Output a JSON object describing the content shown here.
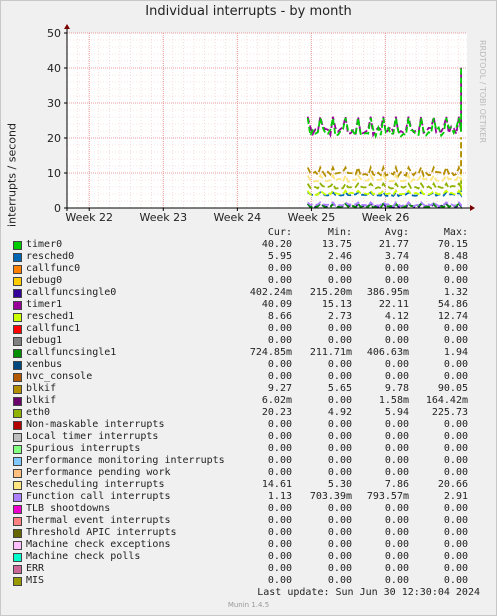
{
  "title": "Individual interrupts - by month",
  "watermark": "RRDTOOL / TOBI OETIKER",
  "footer": {
    "last_update": "Last update:  Sun Jun 30 12:30:04 2024",
    "version": "Munin 1.4.5"
  },
  "legend_headers": {
    "cur": "Cur:",
    "min": "Min:",
    "avg": "Avg:",
    "max": "Max:"
  },
  "legend": [
    {
      "name": "timer0",
      "color": "#00cc00",
      "cur": "40.20",
      "min": "13.75",
      "avg": "21.77",
      "max": "70.15"
    },
    {
      "name": "resched0",
      "color": "#0066b3",
      "cur": "5.95",
      "min": "2.46",
      "avg": "3.74",
      "max": "8.48"
    },
    {
      "name": "callfunc0",
      "color": "#ff8000",
      "cur": "0.00",
      "min": "0.00",
      "avg": "0.00",
      "max": "0.00"
    },
    {
      "name": "debug0",
      "color": "#ffcc00",
      "cur": "0.00",
      "min": "0.00",
      "avg": "0.00",
      "max": "0.00"
    },
    {
      "name": "callfuncsingle0",
      "color": "#330099",
      "cur": "402.24m",
      "min": "215.20m",
      "avg": "386.95m",
      "max": "1.32"
    },
    {
      "name": "timer1",
      "color": "#990099",
      "cur": "40.09",
      "min": "15.13",
      "avg": "22.11",
      "max": "54.86"
    },
    {
      "name": "resched1",
      "color": "#ccff00",
      "cur": "8.66",
      "min": "2.73",
      "avg": "4.12",
      "max": "12.74"
    },
    {
      "name": "callfunc1",
      "color": "#ff0000",
      "cur": "0.00",
      "min": "0.00",
      "avg": "0.00",
      "max": "0.00"
    },
    {
      "name": "debug1",
      "color": "#808080",
      "cur": "0.00",
      "min": "0.00",
      "avg": "0.00",
      "max": "0.00"
    },
    {
      "name": "callfuncsingle1",
      "color": "#008f00",
      "cur": "724.85m",
      "min": "211.71m",
      "avg": "406.63m",
      "max": "1.94"
    },
    {
      "name": "xenbus",
      "color": "#00487d",
      "cur": "0.00",
      "min": "0.00",
      "avg": "0.00",
      "max": "0.00"
    },
    {
      "name": "hvc_console",
      "color": "#b35a00",
      "cur": "0.00",
      "min": "0.00",
      "avg": "0.00",
      "max": "0.00"
    },
    {
      "name": "blkif",
      "color": "#b38f00",
      "cur": "9.27",
      "min": "5.65",
      "avg": "9.78",
      "max": "90.05"
    },
    {
      "name": "blkif",
      "color": "#6b006b",
      "cur": "6.02m",
      "min": "0.00",
      "avg": "1.58m",
      "max": "164.42m"
    },
    {
      "name": "eth0",
      "color": "#8fb300",
      "cur": "20.23",
      "min": "4.92",
      "avg": "5.94",
      "max": "225.73"
    },
    {
      "name": "Non-maskable interrupts",
      "color": "#b30000",
      "cur": "0.00",
      "min": "0.00",
      "avg": "0.00",
      "max": "0.00"
    },
    {
      "name": "Local timer interrupts",
      "color": "#bebebe",
      "cur": "0.00",
      "min": "0.00",
      "avg": "0.00",
      "max": "0.00"
    },
    {
      "name": "Spurious interrupts",
      "color": "#80ff80",
      "cur": "0.00",
      "min": "0.00",
      "avg": "0.00",
      "max": "0.00"
    },
    {
      "name": "Performance monitoring interrupts",
      "color": "#80c9ff",
      "cur": "0.00",
      "min": "0.00",
      "avg": "0.00",
      "max": "0.00"
    },
    {
      "name": "Performance pending work",
      "color": "#ffc080",
      "cur": "0.00",
      "min": "0.00",
      "avg": "0.00",
      "max": "0.00"
    },
    {
      "name": "Rescheduling interrupts",
      "color": "#ffe680",
      "cur": "14.61",
      "min": "5.30",
      "avg": "7.86",
      "max": "20.66"
    },
    {
      "name": "Function call interrupts",
      "color": "#aa80ff",
      "cur": "1.13",
      "min": "703.39m",
      "avg": "793.57m",
      "max": "2.91"
    },
    {
      "name": "TLB shootdowns",
      "color": "#ee00cc",
      "cur": "0.00",
      "min": "0.00",
      "avg": "0.00",
      "max": "0.00"
    },
    {
      "name": "Thermal event interrupts",
      "color": "#ff8080",
      "cur": "0.00",
      "min": "0.00",
      "avg": "0.00",
      "max": "0.00"
    },
    {
      "name": "Threshold APIC interrupts",
      "color": "#666600",
      "cur": "0.00",
      "min": "0.00",
      "avg": "0.00",
      "max": "0.00"
    },
    {
      "name": "Machine check exceptions",
      "color": "#ffbfff",
      "cur": "0.00",
      "min": "0.00",
      "avg": "0.00",
      "max": "0.00"
    },
    {
      "name": "Machine check polls",
      "color": "#00ffcc",
      "cur": "0.00",
      "min": "0.00",
      "avg": "0.00",
      "max": "0.00"
    },
    {
      "name": "ERR",
      "color": "#cc6699",
      "cur": "0.00",
      "min": "0.00",
      "avg": "0.00",
      "max": "0.00"
    },
    {
      "name": "MIS",
      "color": "#999900",
      "cur": "0.00",
      "min": "0.00",
      "avg": "0.00",
      "max": "0.00"
    }
  ],
  "chart_data": {
    "type": "line",
    "title": "Individual interrupts - by month",
    "ylabel": "interrupts / second",
    "ylim": [
      0,
      50
    ],
    "yticks": [
      0,
      10,
      20,
      30,
      40,
      50
    ],
    "xlim": [
      21.7,
      27.1
    ],
    "xticks": [
      {
        "label": "Week 22",
        "pos": 22
      },
      {
        "label": "Week 23",
        "pos": 23
      },
      {
        "label": "Week 24",
        "pos": 24
      },
      {
        "label": "Week 25",
        "pos": 25
      },
      {
        "label": "Week 26",
        "pos": 26
      }
    ],
    "data_start": 24.95,
    "data_end": 27.05,
    "series": [
      {
        "name": "timer0",
        "color": "#00cc00",
        "base": 21.8,
        "spike": 40.2
      },
      {
        "name": "timer1",
        "color": "#990099",
        "base": 22.1,
        "spike": 40.1
      },
      {
        "name": "blkif",
        "color": "#b38f00",
        "base": 9.8,
        "spike": 20
      },
      {
        "name": "Rescheduling interrupts",
        "color": "#ffe680",
        "base": 7.9,
        "spike": 14.6
      },
      {
        "name": "eth0",
        "color": "#8fb300",
        "base": 5.9,
        "spike": 20.2
      },
      {
        "name": "resched1",
        "color": "#ccff00",
        "base": 4.1,
        "spike": 8.7
      },
      {
        "name": "resched0",
        "color": "#0066b3",
        "base": 3.7,
        "spike": 6.0
      },
      {
        "name": "Function call interrupts",
        "color": "#aa80ff",
        "base": 0.8,
        "spike": 1.1
      },
      {
        "name": "callfuncsingle1",
        "color": "#008f00",
        "base": 0.4,
        "spike": 0.7
      },
      {
        "name": "callfuncsingle0",
        "color": "#330099",
        "base": 0.4,
        "spike": 0.4
      }
    ]
  }
}
